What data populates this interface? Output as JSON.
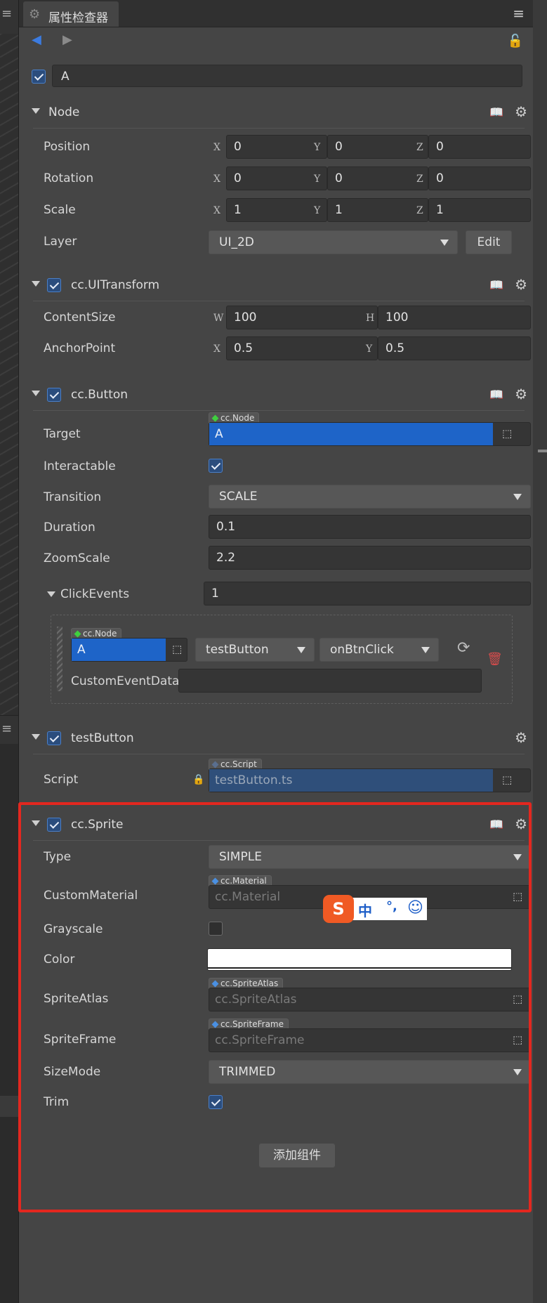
{
  "left_panel": {
    "tab_menu": "≡",
    "lower_menu": "≡"
  },
  "tab": {
    "title": "属性检查器",
    "icon": "gear-icon",
    "menu_icon": "≡"
  },
  "nav": {
    "prev": "◀",
    "next": "▶",
    "lock": "🔓"
  },
  "node_name": "A",
  "node_section": {
    "title": "Node",
    "position": {
      "label": "Position",
      "x_label": "X",
      "x": "0",
      "y_label": "Y",
      "y": "0",
      "z_label": "Z",
      "z": "0"
    },
    "rotation": {
      "label": "Rotation",
      "x_label": "X",
      "x": "0",
      "y_label": "Y",
      "y": "0",
      "z_label": "Z",
      "z": "0"
    },
    "scale": {
      "label": "Scale",
      "x_label": "X",
      "x": "1",
      "y_label": "Y",
      "y": "1",
      "z_label": "Z",
      "z": "1"
    },
    "layer": {
      "label": "Layer",
      "value": "UI_2D",
      "edit": "Edit"
    }
  },
  "uitransform": {
    "title": "cc.UITransform",
    "content_size": {
      "label": "ContentSize",
      "w_label": "W",
      "w": "100",
      "h_label": "H",
      "h": "100"
    },
    "anchor_point": {
      "label": "AnchorPoint",
      "x_label": "X",
      "x": "0.5",
      "y_label": "Y",
      "y": "0.5"
    }
  },
  "button": {
    "title": "cc.Button",
    "target": {
      "label": "Target",
      "type_tag": "cc.Node",
      "value": "A"
    },
    "interactable": {
      "label": "Interactable",
      "checked": true
    },
    "transition": {
      "label": "Transition",
      "value": "SCALE"
    },
    "duration": {
      "label": "Duration",
      "value": "0.1"
    },
    "zoom_scale": {
      "label": "ZoomScale",
      "value": "2.2"
    },
    "click_events": {
      "label": "ClickEvents",
      "count": "1",
      "event": {
        "node_tag": "cc.Node",
        "node": "A",
        "component": "testButton",
        "handler": "onBtnClick",
        "custom_label": "CustomEventData",
        "custom_value": ""
      }
    }
  },
  "test_button": {
    "title": "testButton",
    "script": {
      "label": "Script",
      "type_tag": "cc.Script",
      "value": "testButton.ts"
    }
  },
  "sprite": {
    "title": "cc.Sprite",
    "type": {
      "label": "Type",
      "value": "SIMPLE"
    },
    "custom_material": {
      "label": "CustomMaterial",
      "type_tag": "cc.Material",
      "placeholder": "cc.Material"
    },
    "grayscale": {
      "label": "Grayscale",
      "checked": false
    },
    "color": {
      "label": "Color",
      "value": "#ffffff"
    },
    "sprite_atlas": {
      "label": "SpriteAtlas",
      "type_tag": "cc.SpriteAtlas",
      "placeholder": "cc.SpriteAtlas"
    },
    "sprite_frame": {
      "label": "SpriteFrame",
      "type_tag": "cc.SpriteFrame",
      "placeholder": "cc.SpriteFrame"
    },
    "size_mode": {
      "label": "SizeMode",
      "value": "TRIMMED"
    },
    "trim": {
      "label": "Trim",
      "checked": true
    }
  },
  "add_component": "添加组件",
  "ime": {
    "logo": "S",
    "mode": "中",
    "punct": "°,",
    "emoji": "☺"
  },
  "colors": {
    "accent": "#3b7be0",
    "selection": "#1e64c8",
    "highlight_box": "#e3271f",
    "script_field": "#2f4f7a"
  }
}
